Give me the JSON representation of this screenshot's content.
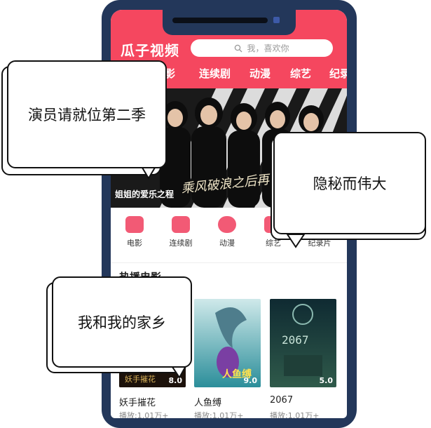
{
  "app": {
    "title": "瓜子视频",
    "search_placeholder": "我，喜欢你"
  },
  "tabs": [
    "电影",
    "连续剧",
    "动漫",
    "综艺",
    "纪录"
  ],
  "banner": {
    "caption": "姐姐的爱乐之程",
    "slogan": "乘风破浪之后再出发!"
  },
  "categories": [
    {
      "label": "电影",
      "icon": "film-icon"
    },
    {
      "label": "连续剧",
      "icon": "tv-series-icon"
    },
    {
      "label": "动漫",
      "icon": "bear-icon"
    },
    {
      "label": "综艺",
      "icon": "variety-icon"
    },
    {
      "label": "纪录片",
      "icon": "documentary-icon"
    }
  ],
  "section": {
    "title": "热播电影"
  },
  "movies": [
    {
      "name": "妖手摧花",
      "plays": "播放:1.01万+",
      "score": "8.0"
    },
    {
      "name": "人鱼缚",
      "plays": "播放:1.01万+",
      "score": "9.0"
    },
    {
      "name": "2067",
      "plays": "播放:1.01万+",
      "score": "5.0"
    }
  ],
  "bubbles": [
    {
      "text": "演员请就位第二季"
    },
    {
      "text": "隐秘而伟大"
    },
    {
      "text": "我和我的家乡"
    }
  ],
  "colors": {
    "header": "#f5475f",
    "frame": "#23375a",
    "accent": "#f25a75"
  }
}
